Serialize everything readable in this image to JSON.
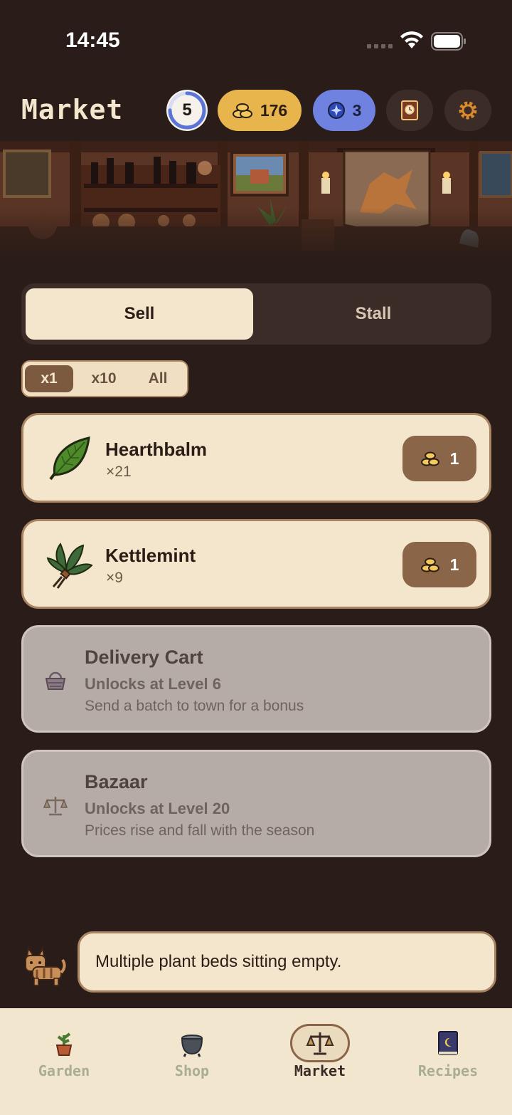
{
  "status_bar": {
    "time": "14:45"
  },
  "header": {
    "title": "Market",
    "level": "5",
    "level_progress": 0.75,
    "coins": "176",
    "gems": "3",
    "journal_icon": "clock-book-icon",
    "settings_icon": "gear-icon"
  },
  "tabs": {
    "sell": "Sell",
    "stall": "Stall",
    "selected": "Sell"
  },
  "quantity": {
    "options": [
      "x1",
      "x10",
      "All"
    ],
    "selected": "x1"
  },
  "items": [
    {
      "name": "Hearthbalm",
      "qty": "×21",
      "price": "1",
      "icon": "leaf-icon"
    },
    {
      "name": "Kettlemint",
      "qty": "×9",
      "price": "1",
      "icon": "herb-bundle-icon"
    }
  ],
  "locked": [
    {
      "name": "Delivery Cart",
      "requirement": "Unlocks at Level 6",
      "description": "Send a batch to town for a bonus",
      "icon": "basket-icon"
    },
    {
      "name": "Bazaar",
      "requirement": "Unlocks at Level 20",
      "description": "Prices rise and fall with the season",
      "icon": "scales-icon"
    }
  ],
  "hint": {
    "text": "Multiple plant beds sitting empty.",
    "icon": "cat-icon"
  },
  "nav": [
    {
      "label": "Garden",
      "icon": "potted-plant-icon"
    },
    {
      "label": "Shop",
      "icon": "cauldron-icon"
    },
    {
      "label": "Market",
      "icon": "scales-icon",
      "active": true
    },
    {
      "label": "Recipes",
      "icon": "moon-book-icon"
    }
  ],
  "colors": {
    "background": "#2a1c18",
    "card": "#f4e6cc",
    "coin_pill": "#e7b54c",
    "gem_pill": "#6f82e0",
    "sell_button": "#8a6547",
    "locked_card": "#b6aca7"
  }
}
